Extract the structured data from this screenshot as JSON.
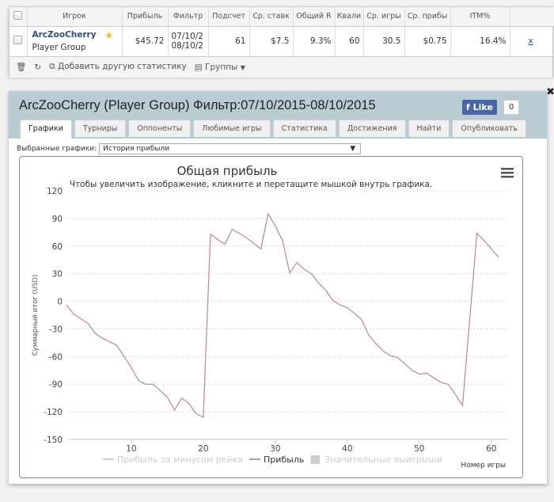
{
  "table": {
    "headers": [
      "Игрок",
      "Прибыль",
      "Фильтр",
      "Подсчет",
      "Ср. ставк",
      "Общий R",
      "Квали",
      "Ср. игры",
      "Ср. прибы",
      "ITM%"
    ],
    "row": {
      "player": "ArcZooCherry",
      "group": "Player Group",
      "profit": "$45.72",
      "filter_from": "07/10/2",
      "filter_to": "08/10/2",
      "count": "61",
      "avg_stake": "$7.5",
      "roi": "9.3%",
      "quali": "60",
      "avg_games": "30.5",
      "avg_profit": "$0.75",
      "itm": "16.4%",
      "remove": "x"
    },
    "toolbar": {
      "add_stat": "Добавить другую статистику",
      "groups": "Группы"
    }
  },
  "panel": {
    "title": "ArcZooCherry (Player Group) Фильтр:07/10/2015-08/10/2015",
    "like": "Like",
    "like_count": "0",
    "tabs": [
      "Графики",
      "Турниры",
      "Оппоненты",
      "Любимые игры",
      "Статистика",
      "Достижения",
      "Найти",
      "Опубликовать"
    ],
    "active_tab": "Графики",
    "select_label": "Выбранные графики:",
    "select_value": "История прибыли"
  },
  "chart_data": {
    "type": "line",
    "title": "Общая прибыль",
    "subtitle": "Чтобы увеличить изображение, кликните и перетащите мышкой внутрь графика.",
    "xlabel": "Номер игры",
    "ylabel": "Суммарный итог (USD)",
    "ylim": [
      -150,
      120
    ],
    "yticks": [
      120,
      90,
      60,
      30,
      0,
      -30,
      -60,
      -90,
      -120,
      -150
    ],
    "xticks": [
      10,
      20,
      30,
      40,
      50,
      60
    ],
    "xlim": [
      1,
      62
    ],
    "grid": true,
    "legend": "bottom",
    "legend_items": [
      {
        "name": "Прибыль за минусом рейка",
        "color": "#cccccc",
        "enabled": false
      },
      {
        "name": "Прибыль",
        "color": "#c09898",
        "enabled": true
      },
      {
        "name": "Значительные выигрыши",
        "color": "#cccccc",
        "enabled": false
      }
    ],
    "series": [
      {
        "name": "Прибыль",
        "color": "#b88a8a",
        "x": [
          1,
          2,
          3,
          4,
          5,
          6,
          7,
          8,
          9,
          10,
          11,
          12,
          13,
          14,
          15,
          16,
          17,
          18,
          19,
          20,
          21,
          22,
          23,
          24,
          25,
          26,
          27,
          28,
          29,
          30,
          31,
          32,
          33,
          34,
          35,
          36,
          37,
          38,
          39,
          40,
          41,
          42,
          43,
          44,
          45,
          46,
          47,
          48,
          49,
          50,
          51,
          52,
          53,
          54,
          55,
          56,
          57,
          58,
          59,
          60,
          61
        ],
        "values": [
          -4,
          -14,
          -19,
          -24,
          -35,
          -40,
          -44,
          -48,
          -60,
          -72,
          -86,
          -90,
          -90,
          -97,
          -104,
          -118,
          -105,
          -111,
          -122,
          -126,
          73,
          67,
          62,
          78,
          74,
          69,
          63,
          57,
          95,
          82,
          66,
          31,
          42,
          35,
          30,
          20,
          12,
          1,
          -4,
          -7,
          -13,
          -20,
          -37,
          -46,
          -54,
          -59,
          -61,
          -68,
          -75,
          -79,
          -78,
          -83,
          -88,
          -90,
          -101,
          -113,
          -20,
          74,
          66,
          57,
          48
        ]
      }
    ]
  }
}
